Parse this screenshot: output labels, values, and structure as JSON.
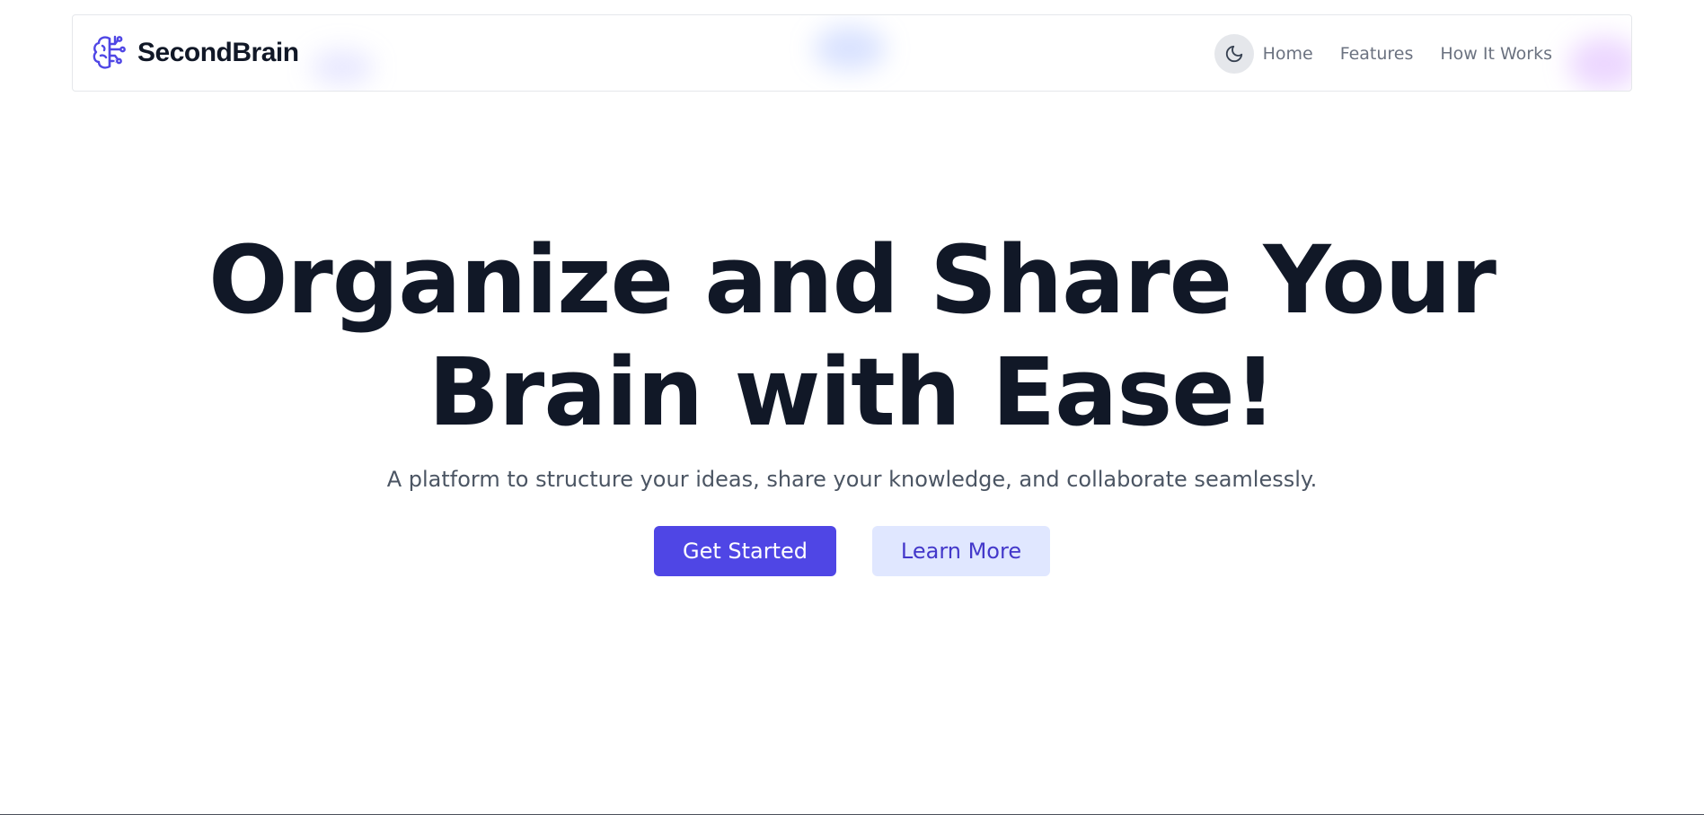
{
  "navbar": {
    "brand_name": "SecondBrain",
    "brand_icon": "brain-circuit-icon",
    "theme_toggle_icon": "moon-icon",
    "links": [
      {
        "label": "Home"
      },
      {
        "label": "Features"
      },
      {
        "label": "How It Works"
      }
    ]
  },
  "hero": {
    "title_line_1": "Organize and Share Your",
    "title_line_2": "Brain with Ease!",
    "subtitle": "A platform to structure your ideas, share your knowledge, and collaborate seamlessly.",
    "primary_button": "Get Started",
    "secondary_button": "Learn More"
  },
  "colors": {
    "accent": "#4f46e5",
    "accent_light": "#e0e7ff",
    "heading": "#111827",
    "body_text": "#4b5563",
    "nav_text": "#6b7280"
  }
}
